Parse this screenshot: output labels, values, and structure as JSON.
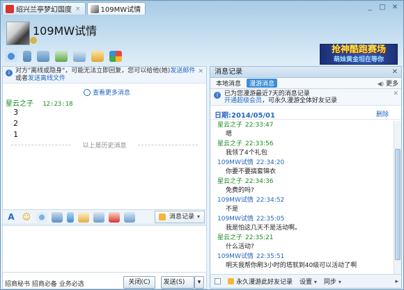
{
  "window": {
    "tabs": [
      {
        "label": "绍兴兰亭梦幻国度",
        "close": "×"
      },
      {
        "label": "109MW试情",
        "close": ""
      }
    ],
    "buttons": {
      "minimize": "_",
      "maximize": "□",
      "close": "✕"
    }
  },
  "contact": {
    "name": "109MW试情"
  },
  "banner": {
    "line1": "抢神酷跑赛场",
    "line2": "萌妹黄金坦在等你"
  },
  "left": {
    "notice": {
      "prefix": "对方\"离线或隐身\"，可能无法立即回复，您可以给他(她)",
      "link1": "发送邮件",
      "middle": "或者",
      "link2": "发送离线文件",
      "close": "✕"
    },
    "view_more": "查看更多消息",
    "message": {
      "sender": "星云之子",
      "time": "12:23:18",
      "lines": [
        "3",
        "2",
        "1"
      ]
    },
    "history_separator": "以上是历史消息",
    "toolbar": {
      "font_icon": "A",
      "emoji_icon": "☺",
      "history_button": "消息记录",
      "history_caret": "▾"
    },
    "bottom_text": "招商秘书 招商必备 业务必选",
    "close_button": "关闭(C)",
    "send_button": "发送(S)",
    "send_caret": "▾"
  },
  "right": {
    "title": "消息记录",
    "close": "✕",
    "tabs": [
      "本地消息",
      "漫游消息"
    ],
    "more": "更多",
    "note": {
      "line1": "已为您漫游最近7天的消息记录",
      "link": "开通超级会员",
      "line2": "，可永久漫游全体好友记录",
      "close": "✕"
    },
    "date": "日期:2014/05/01",
    "delete": "删除",
    "messages": [
      {
        "sender": "星云之子",
        "time": "22:33:47",
        "text": "嗯",
        "color": "green"
      },
      {
        "sender": "星云之子",
        "time": "22:33:56",
        "text": "我领了4个礼包",
        "color": "green"
      },
      {
        "sender": "109MW试情",
        "time": "22:34:20",
        "text": "你要不要搞套锦衣",
        "color": "blue"
      },
      {
        "sender": "星云之子",
        "time": "22:34:36",
        "text": "免费的吗?",
        "color": "green"
      },
      {
        "sender": "109MW试情",
        "time": "22:34:52",
        "text": "不是",
        "color": "blue"
      },
      {
        "sender": "109MW试情",
        "time": "22:35:05",
        "text": "我是怕这几天不是活动啊。",
        "color": "blue"
      },
      {
        "sender": "星云之子",
        "time": "22:35:21",
        "text": "什么活动?",
        "color": "green"
      },
      {
        "sender": "109MW试情",
        "time": "22:35:51",
        "text": "明天我帮你刷3小时的塔就到40级可以活动了啊",
        "color": "blue"
      }
    ],
    "footer": {
      "roam": "永久漫游此好友记录",
      "settings": "设置",
      "sync": "同步",
      "caret": "▾",
      "arrow": "▸"
    }
  }
}
